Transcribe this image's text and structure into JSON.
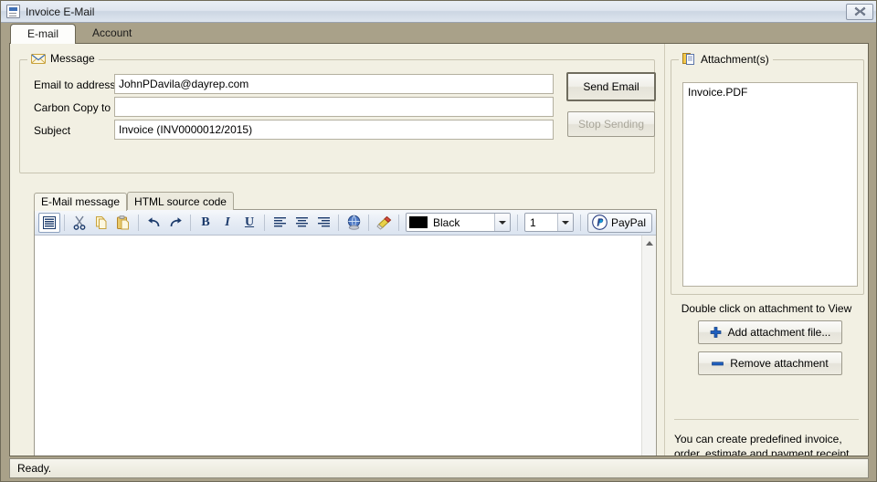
{
  "window": {
    "title": "Invoice E-Mail",
    "icon": "document-mail-icon",
    "close_label": "Close"
  },
  "tabs": [
    {
      "label": "E-mail",
      "active": true
    },
    {
      "label": "Account",
      "active": false
    }
  ],
  "message_group": {
    "legend": "Message",
    "icon": "envelope-icon",
    "fields": [
      {
        "label": "Email to address",
        "value": "JohnPDavila@dayrep.com",
        "placeholder": ""
      },
      {
        "label": "Carbon Copy to",
        "value": "",
        "placeholder": ""
      },
      {
        "label": "Subject",
        "value": "Invoice (INV0000012/2015)",
        "placeholder": ""
      }
    ],
    "buttons": [
      {
        "label": "Send Email",
        "enabled": true
      },
      {
        "label": "Stop Sending",
        "enabled": false
      }
    ]
  },
  "editor": {
    "tabs": [
      {
        "label": "E-Mail message",
        "active": true
      },
      {
        "label": "HTML source code",
        "active": false
      }
    ],
    "toolbar": {
      "icons": [
        "select-all-icon",
        "cut-icon",
        "copy-icon",
        "paste-icon",
        "undo-icon",
        "redo-icon",
        "bold-icon",
        "italic-icon",
        "underline-icon",
        "align-left-icon",
        "align-center-icon",
        "align-right-icon",
        "insert-link-globe-icon",
        "eraser-icon"
      ],
      "bold_label": "B",
      "italic_label": "I",
      "underline_label": "U",
      "color_value": "Black",
      "color_hex": "#000000",
      "size_value": "1",
      "paypal_label": "PayPal"
    },
    "content": ""
  },
  "attachments_group": {
    "legend": "Attachment(s)",
    "icon": "attachment-pages-icon",
    "items": [
      "Invoice.PDF"
    ],
    "hint": "Double click on attachment to View",
    "add_label": "Add attachment file...",
    "remove_label": "Remove attachment",
    "add_icon": "plus-icon",
    "remove_icon": "minus-icon"
  },
  "tip": "You can create predefined invoice, order, estimate and payment receipt email templates under Main menu / Settings / E-Mail templates tab.",
  "statusbar": {
    "text": "Ready."
  },
  "colors": {
    "window_chrome": "#a9a189",
    "panel_bg": "#f2f0e3",
    "toolbar_blue": "#e6ecf5",
    "accent_blue": "#1b3a6b",
    "paypal_blue": "#253b80"
  }
}
